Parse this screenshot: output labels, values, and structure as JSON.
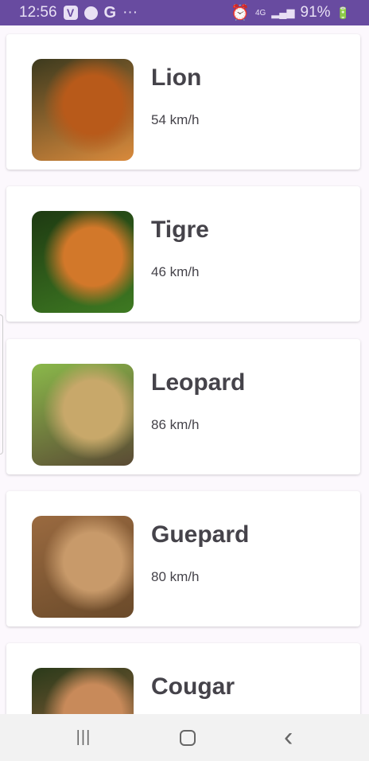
{
  "status": {
    "time": "12:56",
    "apps": [
      "V",
      "messenger",
      "G"
    ],
    "more": "···",
    "network": "4G",
    "battery": "91%"
  },
  "animals": [
    {
      "name": "Lion",
      "speed": "54 km/h",
      "colors": [
        "#3c3a1e",
        "#b85a1a",
        "#d98a3c"
      ]
    },
    {
      "name": "Tigre",
      "speed": "46 km/h",
      "colors": [
        "#1e3a12",
        "#d2782a",
        "#3e7a22"
      ]
    },
    {
      "name": "Leopard",
      "speed": "86 km/h",
      "colors": [
        "#8ab84a",
        "#c8a86a",
        "#5a4a34"
      ]
    },
    {
      "name": "Guepard",
      "speed": "80 km/h",
      "colors": [
        "#9a6a40",
        "#c89a6a",
        "#6a4a2a"
      ]
    },
    {
      "name": "Cougar",
      "speed": "",
      "colors": [
        "#2a3a1a",
        "#c88a5a",
        "#a86a42"
      ]
    }
  ],
  "nav": {
    "recents": "|||",
    "home": "",
    "back": "‹"
  }
}
